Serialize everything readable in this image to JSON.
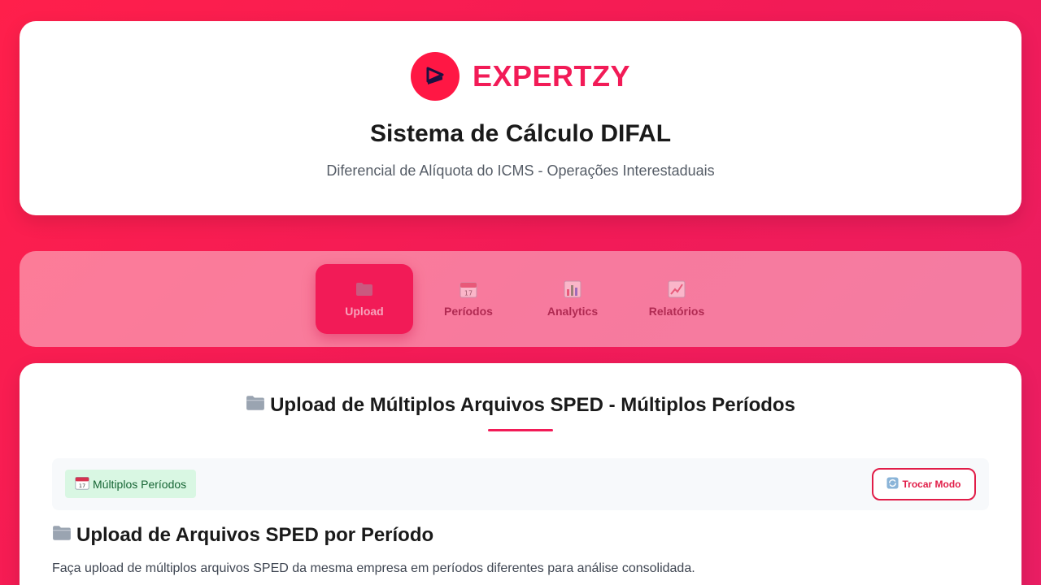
{
  "header": {
    "brand_name": "EXPERTZY",
    "title": "Sistema de Cálculo DIFAL",
    "subtitle": "Diferencial de Alíquota do ICMS - Operações Interestaduais"
  },
  "nav": {
    "tabs": [
      {
        "label": "Upload",
        "icon": "folder-icon",
        "active": true
      },
      {
        "label": "Períodos",
        "icon": "calendar-icon",
        "active": false
      },
      {
        "label": "Analytics",
        "icon": "bar-chart-icon",
        "active": false
      },
      {
        "label": "Relatórios",
        "icon": "trend-chart-icon",
        "active": false
      }
    ]
  },
  "main": {
    "title": "Upload de Múltiplos Arquivos SPED - Múltiplos Períodos",
    "mode_badge": "Múltiplos Períodos",
    "switch_button": "Trocar Modo",
    "section_title": "Upload de Arquivos SPED por Período",
    "section_desc": "Faça upload de múltiplos arquivos SPED da mesma empresa em períodos diferentes para análise consolidada."
  },
  "colors": {
    "brand": "#f21b57",
    "badge_bg": "#d9f7e3",
    "badge_text": "#166534"
  }
}
